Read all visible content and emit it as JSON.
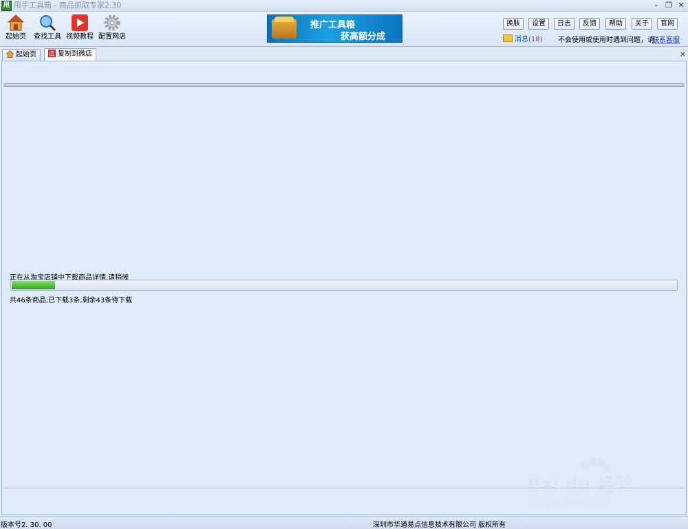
{
  "window": {
    "title": "甩手工具箱 - 商品抓取专家2.30",
    "icon_char": "甩",
    "controls": [
      "–",
      "❐",
      "✕"
    ]
  },
  "toolbar": {
    "tools": [
      {
        "label": "起始页",
        "icon": "home-icon"
      },
      {
        "label": "查找工具",
        "icon": "search-icon"
      },
      {
        "label": "视频教程",
        "icon": "video-play-icon"
      },
      {
        "label": "配置网店",
        "icon": "gear-icon"
      }
    ],
    "banner": {
      "line1": "推广工具箱",
      "line2": "获高额分成"
    },
    "buttons": [
      "换肤",
      "设置",
      "日志",
      "反馈",
      "帮助",
      "关于",
      "官网"
    ],
    "messages_label": "消息(",
    "messages_count": "18",
    "messages_close": ")",
    "help_text": "不会使用或使用时遇到问题，请",
    "contact_link": "联系客服"
  },
  "tabs": [
    {
      "label": "起始页",
      "icon": "home-icon"
    },
    {
      "label": "复制到微店",
      "icon": "shop-icon"
    }
  ],
  "content": {
    "progress_label": "正在从淘宝店铺中下载商品详情,请稍候",
    "progress_value": 0.065,
    "progress_status": "共46条商品,已下载3条,剩余43条待下载"
  },
  "statusbar": {
    "version": "版本号2. 30. 00",
    "copyright": "深圳市华通易点信息技术有限公司  版权所有"
  },
  "watermark": {
    "brand": "Bai du 经验",
    "url": "jingyan.baidu.com"
  },
  "colors": {
    "accent": "#1b55b0",
    "progress": "#2ea51c",
    "badge": "#d0202a"
  }
}
